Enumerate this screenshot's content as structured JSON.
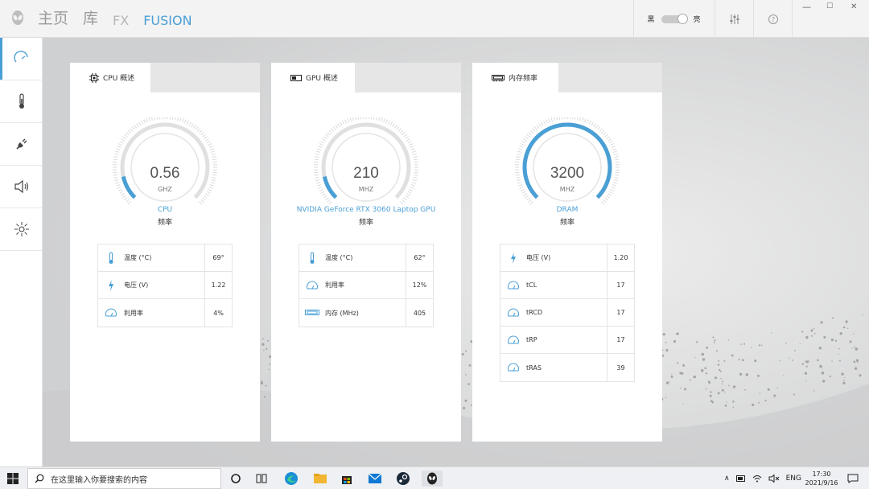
{
  "nav": {
    "home": "主页",
    "library": "库",
    "fx": "FX",
    "fusion": "FUSION"
  },
  "theme_toggle": {
    "dark_label": "黑",
    "light_label": "亮"
  },
  "window_controls": {
    "minimize": "—",
    "maximize": "☐",
    "close": "✕"
  },
  "sidebar": {
    "items": [
      "performance-gauge-icon",
      "thermometer-icon",
      "power-plug-icon",
      "speaker-icon",
      "lighting-icon"
    ]
  },
  "cards": [
    {
      "title": "CPU 概述",
      "value": "0.56",
      "unit": "GHZ",
      "name": "CPU",
      "sub": "频率",
      "fraction": 0.12,
      "metrics": [
        {
          "icon": "thermometer-icon",
          "label": "温度 (°C)",
          "value": "69°"
        },
        {
          "icon": "lightning-icon",
          "label": "电压 (V)",
          "value": "1.22"
        },
        {
          "icon": "usage-icon",
          "label": "利用率",
          "value": "4%"
        }
      ]
    },
    {
      "title": "GPU 概述",
      "value": "210",
      "unit": "MHZ",
      "name": "NVIDIA GeForce RTX 3060 Laptop GPU",
      "sub": "频率",
      "fraction": 0.12,
      "metrics": [
        {
          "icon": "thermometer-icon",
          "label": "温度 (°C)",
          "value": "62°"
        },
        {
          "icon": "usage-icon",
          "label": "利用率",
          "value": "12%"
        },
        {
          "icon": "memory-icon",
          "label": "内存 (MHz)",
          "value": "405"
        }
      ]
    },
    {
      "title": "内存频率",
      "value": "3200",
      "unit": "MHZ",
      "name": "DRAM",
      "sub": "频率",
      "fraction": 1.0,
      "metrics": [
        {
          "icon": "lightning-icon",
          "label": "电压 (V)",
          "value": "1.20"
        },
        {
          "icon": "usage-icon",
          "label": "tCL",
          "value": "17"
        },
        {
          "icon": "usage-icon",
          "label": "tRCD",
          "value": "17"
        },
        {
          "icon": "usage-icon",
          "label": "tRP",
          "value": "17"
        },
        {
          "icon": "usage-icon",
          "label": "tRAS",
          "value": "39"
        }
      ]
    }
  ],
  "taskbar": {
    "search_placeholder": "在这里输入你要搜索的内容",
    "lang": "ENG",
    "time": "17:30",
    "date": "2021/9/16"
  },
  "colors": {
    "accent": "#4a9fd5",
    "track": "#e0e0e0"
  }
}
